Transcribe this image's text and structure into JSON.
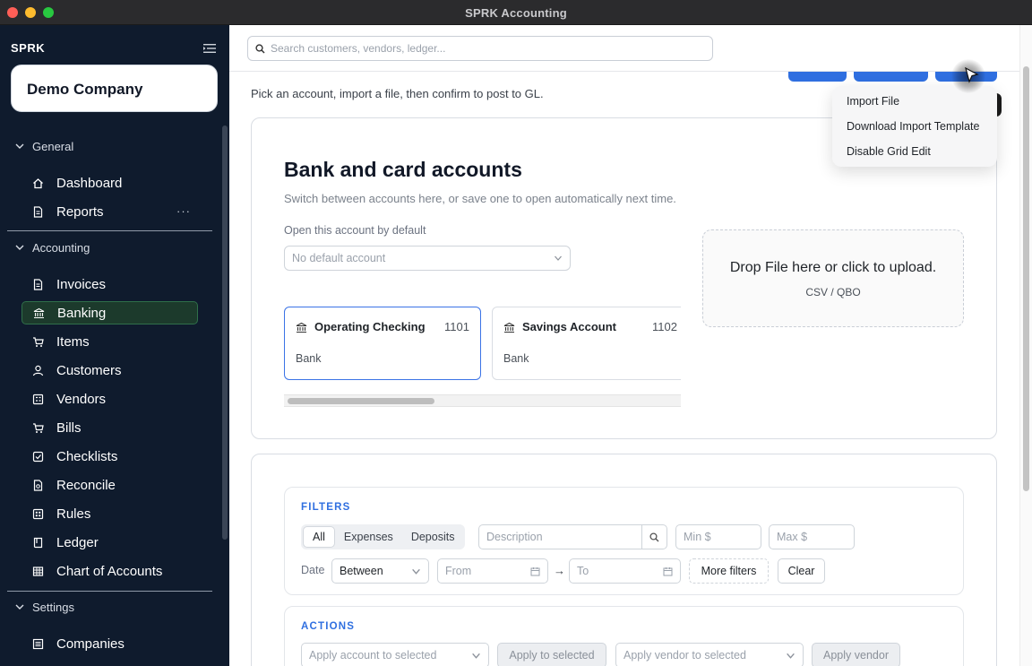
{
  "window": {
    "title": "SPRK Accounting"
  },
  "sidebar": {
    "brand": "SPRK",
    "company": "Demo Company",
    "sections": [
      {
        "label": "General",
        "items": [
          {
            "label": "Dashboard",
            "icon": "home-icon"
          },
          {
            "label": "Reports",
            "icon": "document-icon",
            "more": "···"
          }
        ]
      },
      {
        "label": "Accounting",
        "items": [
          {
            "label": "Invoices",
            "icon": "document-icon"
          },
          {
            "label": "Banking",
            "icon": "bank-icon",
            "active": true
          },
          {
            "label": "Items",
            "icon": "cart-icon"
          },
          {
            "label": "Customers",
            "icon": "user-icon"
          },
          {
            "label": "Vendors",
            "icon": "vendors-icon"
          },
          {
            "label": "Bills",
            "icon": "cart-icon"
          },
          {
            "label": "Checklists",
            "icon": "checklist-icon"
          },
          {
            "label": "Reconcile",
            "icon": "reconcile-icon"
          },
          {
            "label": "Rules",
            "icon": "rules-icon"
          },
          {
            "label": "Ledger",
            "icon": "book-icon"
          },
          {
            "label": "Chart of Accounts",
            "icon": "grid-icon"
          }
        ]
      },
      {
        "label": "Settings",
        "items": [
          {
            "label": "Companies",
            "icon": "companies-icon"
          }
        ]
      }
    ]
  },
  "topbar": {
    "search_placeholder": "Search customers, vendors, ledger..."
  },
  "page": {
    "subtitle": "Pick an account, import a file, then confirm to post to GL."
  },
  "accounts_card": {
    "title": "Bank and card accounts",
    "description": "Switch between accounts here, or save one to open automatically next time.",
    "default_label": "Open this account by default",
    "default_placeholder": "No default account",
    "accounts": [
      {
        "name": "Operating Checking",
        "number": "1101",
        "type": "Bank",
        "selected": true
      },
      {
        "name": "Savings Account",
        "number": "1102",
        "type": "Bank",
        "selected": false
      }
    ],
    "dropzone": {
      "main": "Drop File here or click to upload.",
      "sub": "CSV / QBO"
    }
  },
  "filters": {
    "title": "FILTERS",
    "segments": [
      "All",
      "Expenses",
      "Deposits"
    ],
    "active_segment": "All",
    "description_placeholder": "Description",
    "min_placeholder": "Min $",
    "max_placeholder": "Max $",
    "date_label": "Date",
    "date_mode": "Between",
    "from_placeholder": "From",
    "arrow": "→",
    "to_placeholder": "To",
    "more_filters": "More filters",
    "clear": "Clear"
  },
  "actions": {
    "title": "ACTIONS",
    "apply_account_placeholder": "Apply account to selected",
    "apply_to_selected": "Apply to selected",
    "apply_vendor_placeholder": "Apply vendor to selected",
    "apply_vendor": "Apply vendor"
  },
  "menu": {
    "items": [
      "Import File",
      "Download Import Template",
      "Disable Grid Edit"
    ]
  },
  "colors": {
    "sidebar_bg": "#0f1b2d",
    "accent": "#2f6fe0",
    "active_nav": "#1c3a2c"
  }
}
